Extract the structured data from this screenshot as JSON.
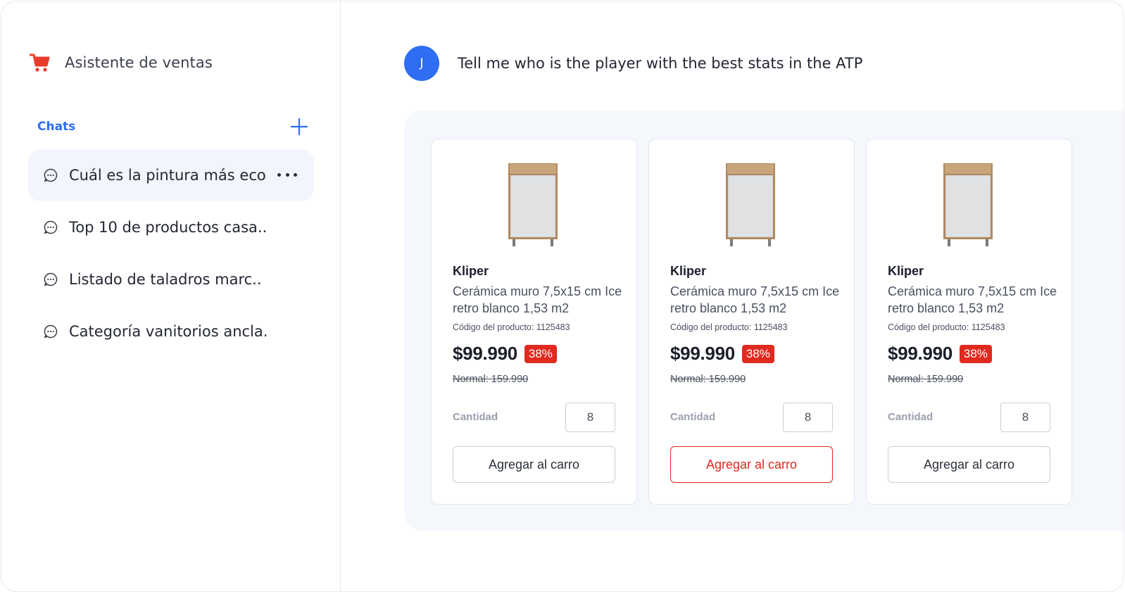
{
  "app": {
    "title": "Asistente de ventas",
    "icon": "shopping-cart-icon",
    "accent_color": "#e83b2b"
  },
  "sidebar": {
    "chats_label": "Chats",
    "new_chat_icon": "plus-icon",
    "items": [
      {
        "label": "Cuál es la pintura más eco",
        "active": true
      },
      {
        "label": "Top 10 de productos casa..",
        "active": false
      },
      {
        "label": "Listado de taladros marc..",
        "active": false
      },
      {
        "label": "Categoría vanitorios ancla.",
        "active": false
      }
    ]
  },
  "conversation": {
    "user": {
      "initial": "J",
      "message": "Tell me who is the player with the best stats in the ATP",
      "avatar_color": "#2f6df2"
    },
    "products": [
      {
        "brand": "Kliper",
        "name": "Cerámica muro 7,5x15 cm Ice retro blanco 1,53 m2",
        "code": "Código del producto: 1125483",
        "price": "$99.990",
        "discount": "38%",
        "normal_price": "Normal: 159.990",
        "quantity_label": "Cantidad",
        "quantity": "8",
        "button": "Agregar al carro",
        "highlighted": false
      },
      {
        "brand": "Kliper",
        "name": "Cerámica muro 7,5x15 cm Ice retro blanco 1,53 m2",
        "code": "Código del producto: 1125483",
        "price": "$99.990",
        "discount": "38%",
        "normal_price": "Normal: 159.990",
        "quantity_label": "Cantidad",
        "quantity": "8",
        "button": "Agregar al carro",
        "highlighted": true
      },
      {
        "brand": "Kliper",
        "name": "Cerámica muro 7,5x15 cm Ice retro blanco 1,53 m2",
        "code": "Código del producto: 1125483",
        "price": "$99.990",
        "discount": "38%",
        "normal_price": "Normal: 159.990",
        "quantity_label": "Cantidad",
        "quantity": "8",
        "button": "Agregar al carro",
        "highlighted": false
      }
    ]
  },
  "colors": {
    "primary_blue": "#2f6df2",
    "discount_red": "#e0291f",
    "panel_bg": "#f4f7fc"
  }
}
